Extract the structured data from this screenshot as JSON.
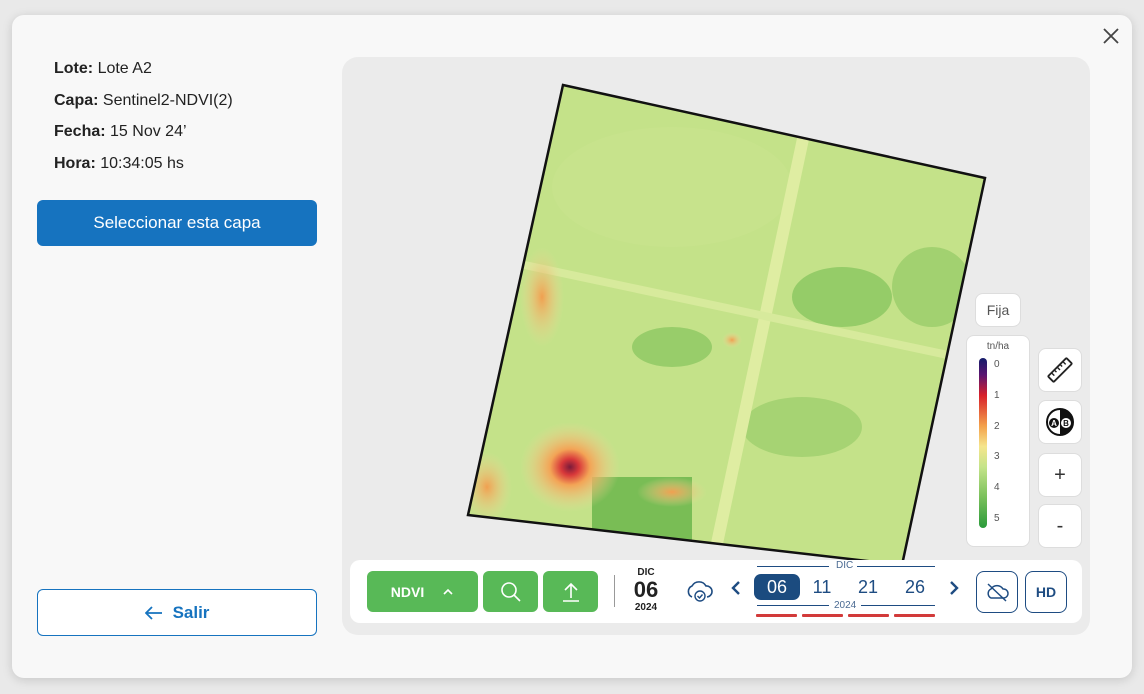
{
  "info": {
    "lote_label": "Lote:",
    "lote_value": "Lote A2",
    "capa_label": "Capa:",
    "capa_value": "Sentinel2-NDVI(2)",
    "fecha_label": "Fecha:",
    "fecha_value": "15 Nov 24’",
    "hora_label": "Hora:",
    "hora_value": "10:34:05 hs"
  },
  "buttons": {
    "select_layer": "Seleccionar esta capa",
    "exit": "Salir"
  },
  "map": {
    "fija_label": "Fija",
    "legend": {
      "unit": "tn/ha",
      "ticks": [
        "0",
        "1",
        "2",
        "3",
        "4",
        "5"
      ]
    },
    "tools": {
      "zoom_in": "+",
      "zoom_out": "-",
      "compare_a": "A",
      "compare_b": "B"
    }
  },
  "toolbar": {
    "layer_label": "NDVI",
    "selected_date": {
      "month": "DIC",
      "day": "06",
      "year": "2024"
    },
    "date_strip": {
      "month": "DIC",
      "year": "2024",
      "days": [
        "06",
        "11",
        "21",
        "26"
      ],
      "selected_index": 0
    },
    "hd_label": "HD"
  },
  "colors": {
    "primary_blue": "#1673bf",
    "dark_blue": "#1b4b7f",
    "green": "#58b957",
    "red": "#d23a3a"
  },
  "icons": [
    "close-icon",
    "arrow-left-icon",
    "ruler-icon",
    "compare-ab-icon",
    "chevron-up-icon",
    "search-icon",
    "upload-icon",
    "cloud-check-icon",
    "chevron-left-icon",
    "chevron-right-icon",
    "cloud-off-icon"
  ]
}
